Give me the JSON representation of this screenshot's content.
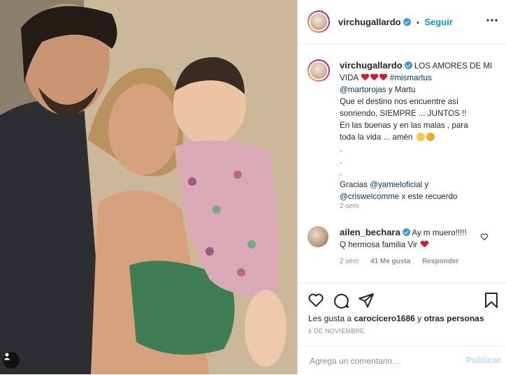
{
  "header": {
    "username": "virchugallardo",
    "separator": "•",
    "follow_label": "Seguir"
  },
  "caption": {
    "username": "virchugallardo",
    "line1": "LOS AMORES DE MI",
    "line2_prefix": "VIDA",
    "hashtag": "#mismartus",
    "mention1": "@martorojas",
    "line3_suffix": "y Martu",
    "body": "Que el destino nos encuentre así\nsonriendo, SIEMPRE ... JUNTOS !!\nEn las buenas y en las malas , para\ntoda la vida ... amén",
    "dots": ".\n.\n.",
    "thanks": "Gracias",
    "mention2": "@yamieloficial",
    "and": "y",
    "mention3": "@criswelcomme",
    "tail": "x este recuerdo",
    "time": "2 sem"
  },
  "comment": {
    "username": "ailen_bechara",
    "text1": "Ay m muero!!!!!",
    "text2": "Q hermosa familia Vir",
    "time": "2 sem",
    "likes": "41 Me gusta",
    "reply_label": "Responder"
  },
  "likes": {
    "prefix": "Les gusta a",
    "user": "carocicero1686",
    "middle": "y",
    "others": "otras personas"
  },
  "date": "6 DE NOVIEMBRE",
  "add_comment": {
    "placeholder": "Agrega un comentario...",
    "post_label": "Publicar"
  },
  "icons": {
    "like": "heart-outline-icon",
    "comment": "comment-bubble-icon",
    "share": "paper-plane-icon",
    "save": "bookmark-icon",
    "tags": "user-tag-icon",
    "more": "more-dots-icon"
  },
  "colors": {
    "accent": "#0095f6",
    "verified": "#3897f0",
    "heart": "#e0152d",
    "muted": "#8e8e8e"
  }
}
